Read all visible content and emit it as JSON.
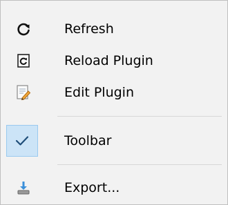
{
  "menu": {
    "items": [
      {
        "label": "Refresh",
        "icon": "refresh-icon"
      },
      {
        "label": "Reload Plugin",
        "icon": "reload-plugin-icon"
      },
      {
        "label": "Edit Plugin",
        "icon": "edit-plugin-icon"
      },
      {
        "label": "Toolbar",
        "icon": "check-icon",
        "checked": true
      },
      {
        "label": "Export...",
        "icon": "export-icon"
      }
    ]
  },
  "colors": {
    "background": "#f2f2f2",
    "check_highlight": "#cce4f7",
    "check_border": "#99c9ef",
    "check_mark": "#1f4e79",
    "separator": "#d7d7d7"
  }
}
